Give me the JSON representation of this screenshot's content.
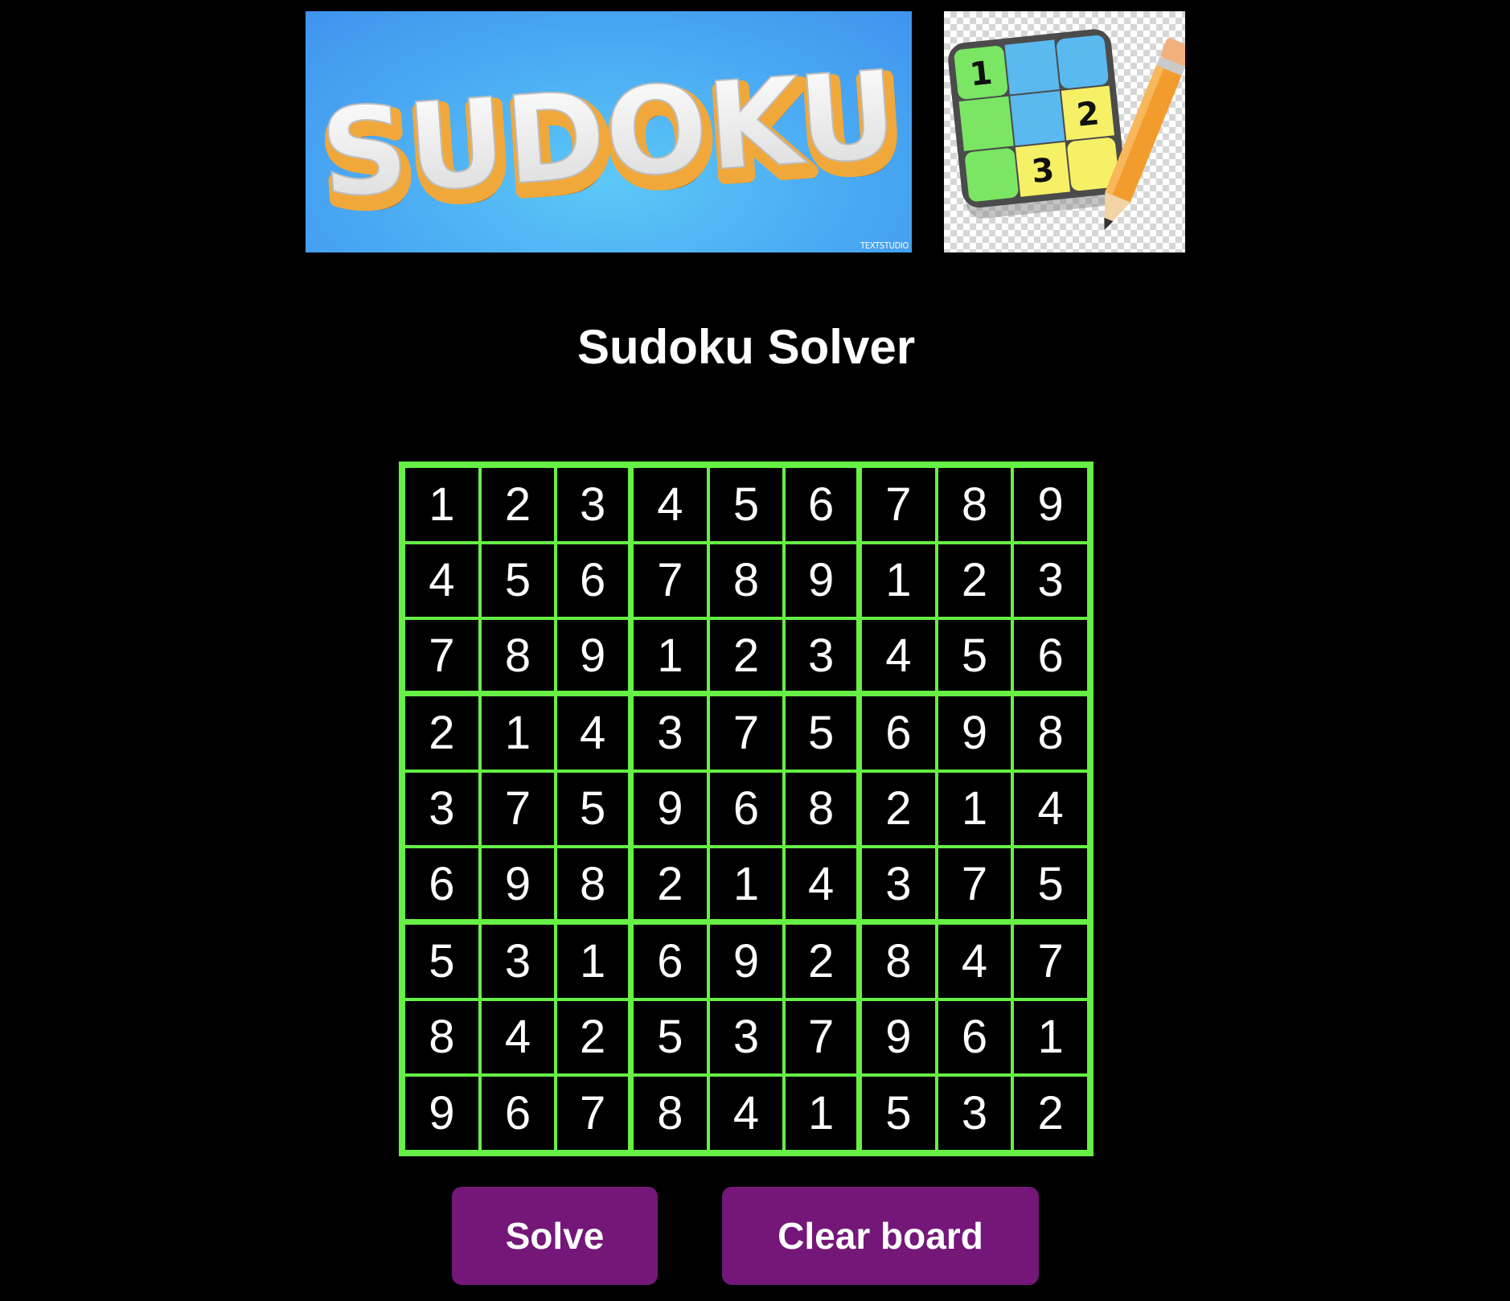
{
  "banner": {
    "logo_text": "SUDOKU",
    "credit": "TEXTSTUDIO"
  },
  "icon": {
    "name": "sudoku-pencil-icon",
    "digits": [
      "1",
      "2",
      "3"
    ]
  },
  "page": {
    "title": "Sudoku Solver"
  },
  "board": {
    "rows": [
      [
        "1",
        "2",
        "3",
        "4",
        "5",
        "6",
        "7",
        "8",
        "9"
      ],
      [
        "4",
        "5",
        "6",
        "7",
        "8",
        "9",
        "1",
        "2",
        "3"
      ],
      [
        "7",
        "8",
        "9",
        "1",
        "2",
        "3",
        "4",
        "5",
        "6"
      ],
      [
        "2",
        "1",
        "4",
        "3",
        "7",
        "5",
        "6",
        "9",
        "8"
      ],
      [
        "3",
        "7",
        "5",
        "9",
        "6",
        "8",
        "2",
        "1",
        "4"
      ],
      [
        "6",
        "9",
        "8",
        "2",
        "1",
        "4",
        "3",
        "7",
        "5"
      ],
      [
        "5",
        "3",
        "1",
        "6",
        "9",
        "2",
        "8",
        "4",
        "7"
      ],
      [
        "8",
        "4",
        "2",
        "5",
        "3",
        "7",
        "9",
        "6",
        "1"
      ],
      [
        "9",
        "6",
        "7",
        "8",
        "4",
        "1",
        "5",
        "3",
        "2"
      ]
    ]
  },
  "buttons": {
    "solve_label": "Solve",
    "clear_label": "Clear board"
  },
  "colors": {
    "background": "#000000",
    "grid_lines": "#66ef45",
    "button": "#741779",
    "text": "#ffffff"
  }
}
